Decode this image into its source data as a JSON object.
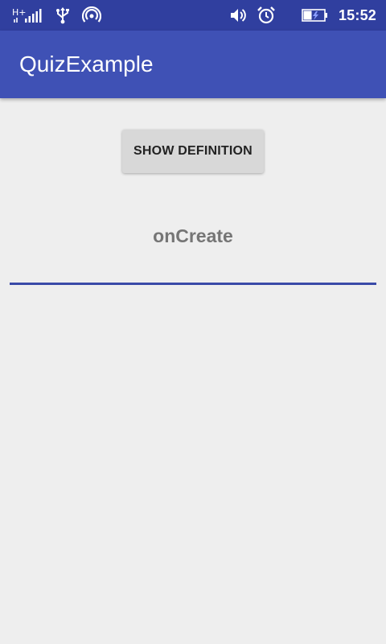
{
  "status_bar": {
    "network_type": "H+",
    "time": "15:52"
  },
  "app_bar": {
    "title": "QuizExample"
  },
  "main": {
    "show_definition_label": "SHOW DEFINITION",
    "term": "onCreate",
    "definition_value": "",
    "definition_placeholder": ""
  },
  "colors": {
    "status_bar": "#303f9f",
    "app_bar": "#3f51b5",
    "background": "#eeeeee",
    "underline": "#3a4aa8"
  },
  "icons": [
    "signal-icon",
    "usb-icon",
    "hotspot-icon",
    "volume-icon",
    "alarm-icon",
    "battery-charging-icon"
  ]
}
